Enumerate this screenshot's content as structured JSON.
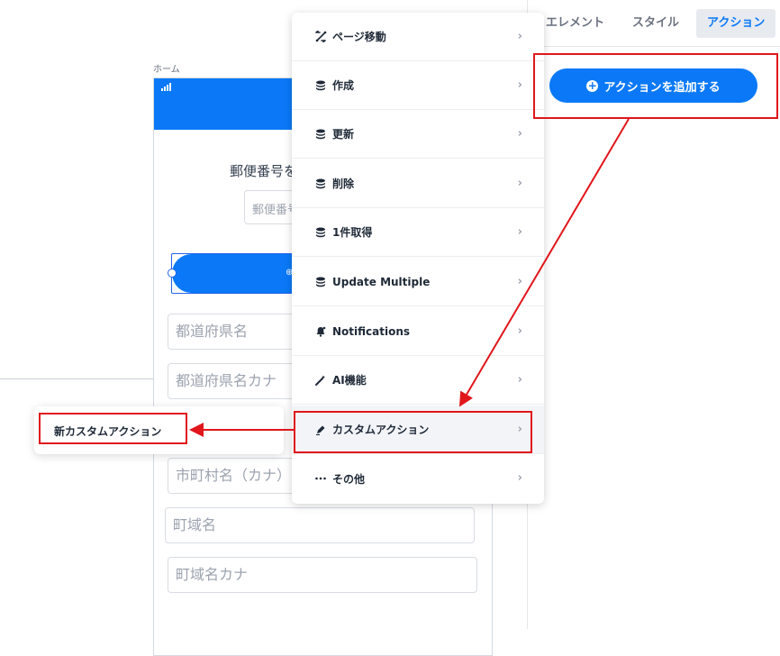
{
  "canvas": {
    "screen_label": "ホーム",
    "title_text": "郵便番号を",
    "zip_placeholder": "郵便番号を",
    "search_icon_glyph": "⊕",
    "fields": [
      "都道府県名",
      "都道府県名カナ",
      "市町村名（カナ）",
      "町域名",
      "町域名カナ"
    ]
  },
  "right_panel": {
    "tabs": [
      "エレメント",
      "スタイル",
      "アクション"
    ],
    "active_tab": "アクション",
    "add_action_label": "アクションを追加する"
  },
  "menu": {
    "items": [
      {
        "label": "ページ移動",
        "icon": "page-transition-icon"
      },
      {
        "label": "作成",
        "icon": "database-icon"
      },
      {
        "label": "更新",
        "icon": "database-icon"
      },
      {
        "label": "削除",
        "icon": "database-icon"
      },
      {
        "label": "1件取得",
        "icon": "database-icon"
      },
      {
        "label": "Update Multiple",
        "icon": "database-icon"
      },
      {
        "label": "Notifications",
        "icon": "bell-icon"
      },
      {
        "label": "AI機能",
        "icon": "magic-wand-icon"
      },
      {
        "label": "カスタムアクション",
        "icon": "pen-icon"
      },
      {
        "label": "その他",
        "icon": "ellipsis-icon"
      }
    ],
    "chevron": "›"
  },
  "submenu": {
    "label": "新カスタムアクション"
  },
  "colors": {
    "accent": "#0b79f7",
    "annotation_red": "#e0161b"
  }
}
